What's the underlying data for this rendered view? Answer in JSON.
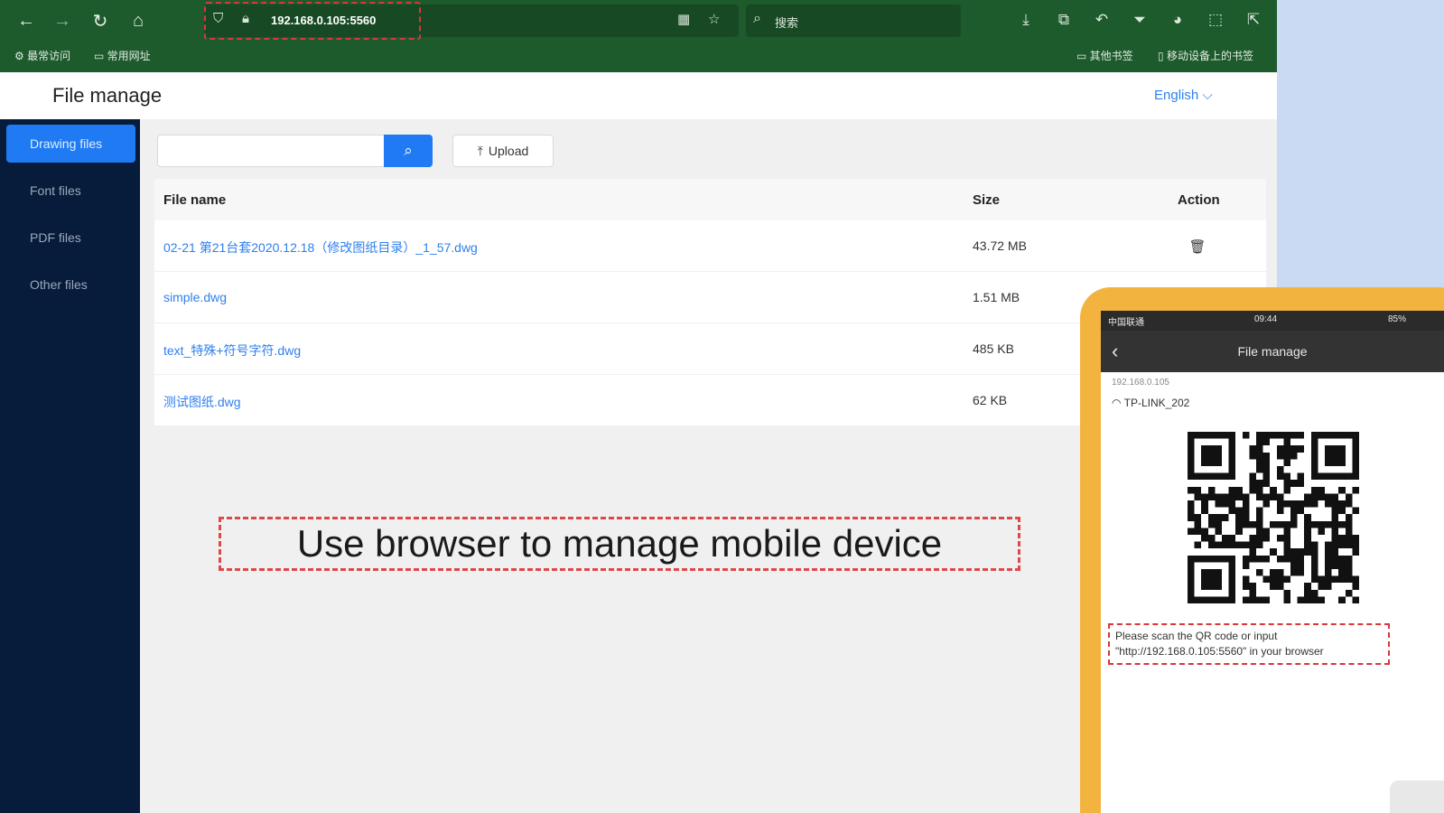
{
  "browser": {
    "url": "192.168.0.105:5560",
    "search_placeholder": "搜索",
    "bookmarks": [
      "最常访问",
      "常用网址"
    ],
    "bookmarks_right": [
      "其他书签",
      "移动设备上的书签"
    ]
  },
  "app": {
    "title": "File manage",
    "language": "English ⌵"
  },
  "sidebar": {
    "items": [
      {
        "label": "Drawing files"
      },
      {
        "label": "Font files"
      },
      {
        "label": "PDF files"
      },
      {
        "label": "Other files"
      }
    ]
  },
  "toolbar": {
    "search_value": "",
    "upload_label": "Upload"
  },
  "table": {
    "headers": {
      "name": "File name",
      "size": "Size",
      "action": "Action"
    },
    "rows": [
      {
        "name": "02-21 第21台套2020.12.18（修改图纸目录）_1_57.dwg",
        "size": "43.72 MB"
      },
      {
        "name": "simple.dwg",
        "size": "1.51 MB"
      },
      {
        "name": "text_特殊+符号字符.dwg",
        "size": "485 KB"
      },
      {
        "name": "测试图纸.dwg",
        "size": "62 KB"
      }
    ]
  },
  "caption": "Use browser to manage mobile device",
  "phone": {
    "carrier": "中国联通",
    "time": "09:44",
    "battery": "85%",
    "title": "File manage",
    "ip_label": "192.168.0.105",
    "wifi": "TP-LINK_202",
    "note": "Please scan the QR code or input \"http://192.168.0.105:5560\" in your browser"
  },
  "colors": {
    "browser_toolbar": "#1d5a2c",
    "sidebar": "#061c3a",
    "accent": "#1f7af3",
    "phone_frame": "#f2b43f",
    "highlight_dash": "#d9373b"
  },
  "icons": [
    "back-icon",
    "forward-icon",
    "reload-icon",
    "home-icon",
    "shield-icon",
    "lock-icon",
    "qr-icon",
    "star-icon",
    "search-icon",
    "download-icon",
    "screenshot-icon",
    "undo-icon",
    "funnel-icon",
    "firefox-icon",
    "extension-icon",
    "popout-icon",
    "upload-icon",
    "delete-icon",
    "wifi-icon",
    "chevron-left-icon"
  ]
}
